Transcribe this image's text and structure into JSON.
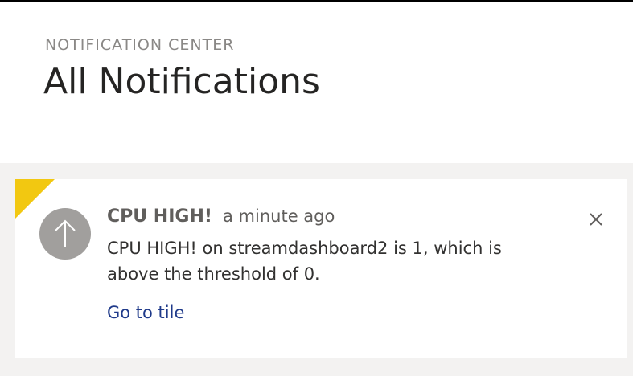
{
  "header": {
    "eyebrow": "NOTIFICATION CENTER",
    "title": "All Notifications"
  },
  "notifications": [
    {
      "title": "CPU HIGH!",
      "time": "a minute ago",
      "message": "CPU HIGH! on streamdashboard2 is 1, which is above the threshold of 0.",
      "link_label": "Go to tile",
      "icon": "arrow-up-icon",
      "close_icon": "close-icon",
      "flag_color": "#f2c811",
      "avatar_color": "#a19f9d"
    }
  ],
  "colors": {
    "accent_link": "#1f3a8a",
    "list_background": "#f3f2f1"
  }
}
